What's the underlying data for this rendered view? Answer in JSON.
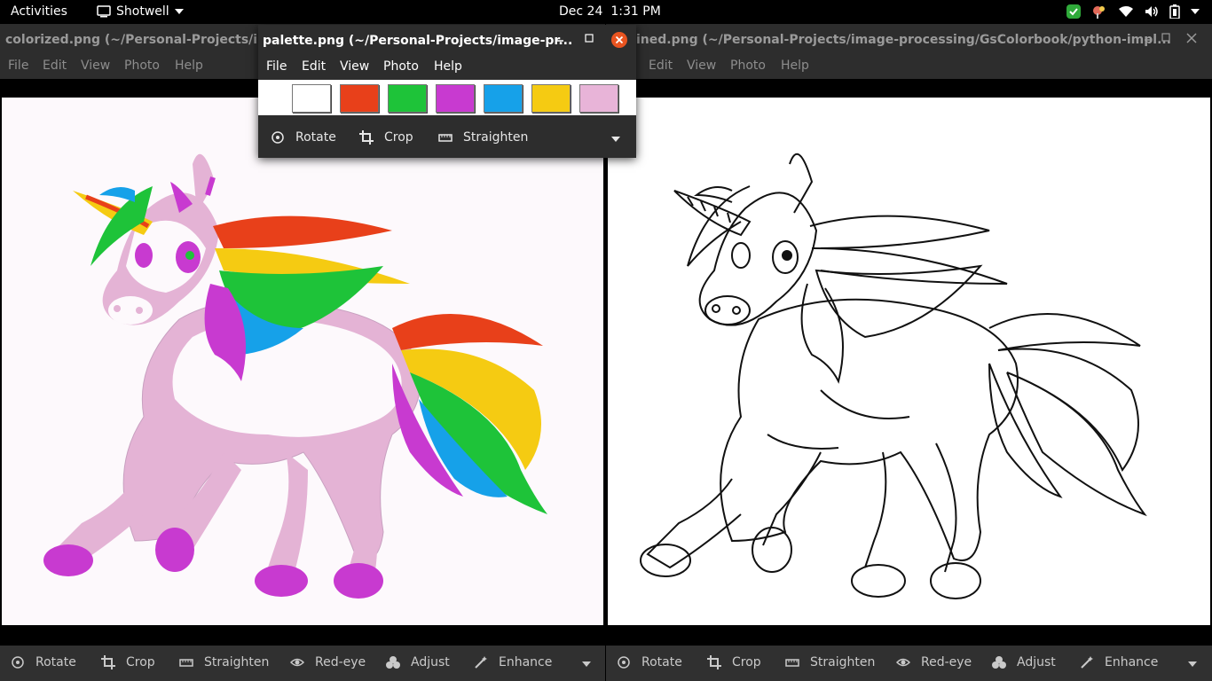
{
  "topbar": {
    "activities": "Activities",
    "app_name": "Shotwell",
    "date": "Dec 24",
    "time": "1:31 PM"
  },
  "left_window": {
    "title": "colorized.png (~/Personal-Projects/image-processing/GsColorbook/python-impl...",
    "menu": [
      "File",
      "Edit",
      "View",
      "Photo",
      "Help"
    ],
    "toolbar": [
      "Rotate",
      "Crop",
      "Straighten",
      "Red-eye",
      "Adjust",
      "Enhance"
    ]
  },
  "right_window": {
    "title": "ined.png (~/Personal-Projects/image-processing/GsColorbook/python-impl...",
    "menu": [
      "Edit",
      "View",
      "Photo",
      "Help"
    ],
    "toolbar": [
      "Rotate",
      "Crop",
      "Straighten",
      "Red-eye",
      "Adjust",
      "Enhance"
    ]
  },
  "palette_window": {
    "title": "palette.png (~/Personal-Projects/image-pr...",
    "menu": [
      "File",
      "Edit",
      "View",
      "Photo",
      "Help"
    ],
    "toolbar": [
      "Rotate",
      "Crop",
      "Straighten"
    ],
    "swatches": [
      "#ffffff",
      "#e8401a",
      "#1ec339",
      "#c83ad0",
      "#16a1e9",
      "#f5cb12",
      "#e8b4d8"
    ]
  },
  "icons": {
    "topbar": [
      "screen-icon",
      "dropdown-caret-icon",
      "shield-check-icon",
      "paint-icon",
      "wifi-icon",
      "volume-icon",
      "battery-icon",
      "power-caret-icon"
    ],
    "toolbar": [
      "rotate-icon",
      "crop-icon",
      "straighten-icon",
      "red-eye-icon",
      "adjust-icon",
      "enhance-icon"
    ]
  },
  "colors": {
    "accent_close": "#e95420",
    "shield_green": "#2faa3a"
  }
}
